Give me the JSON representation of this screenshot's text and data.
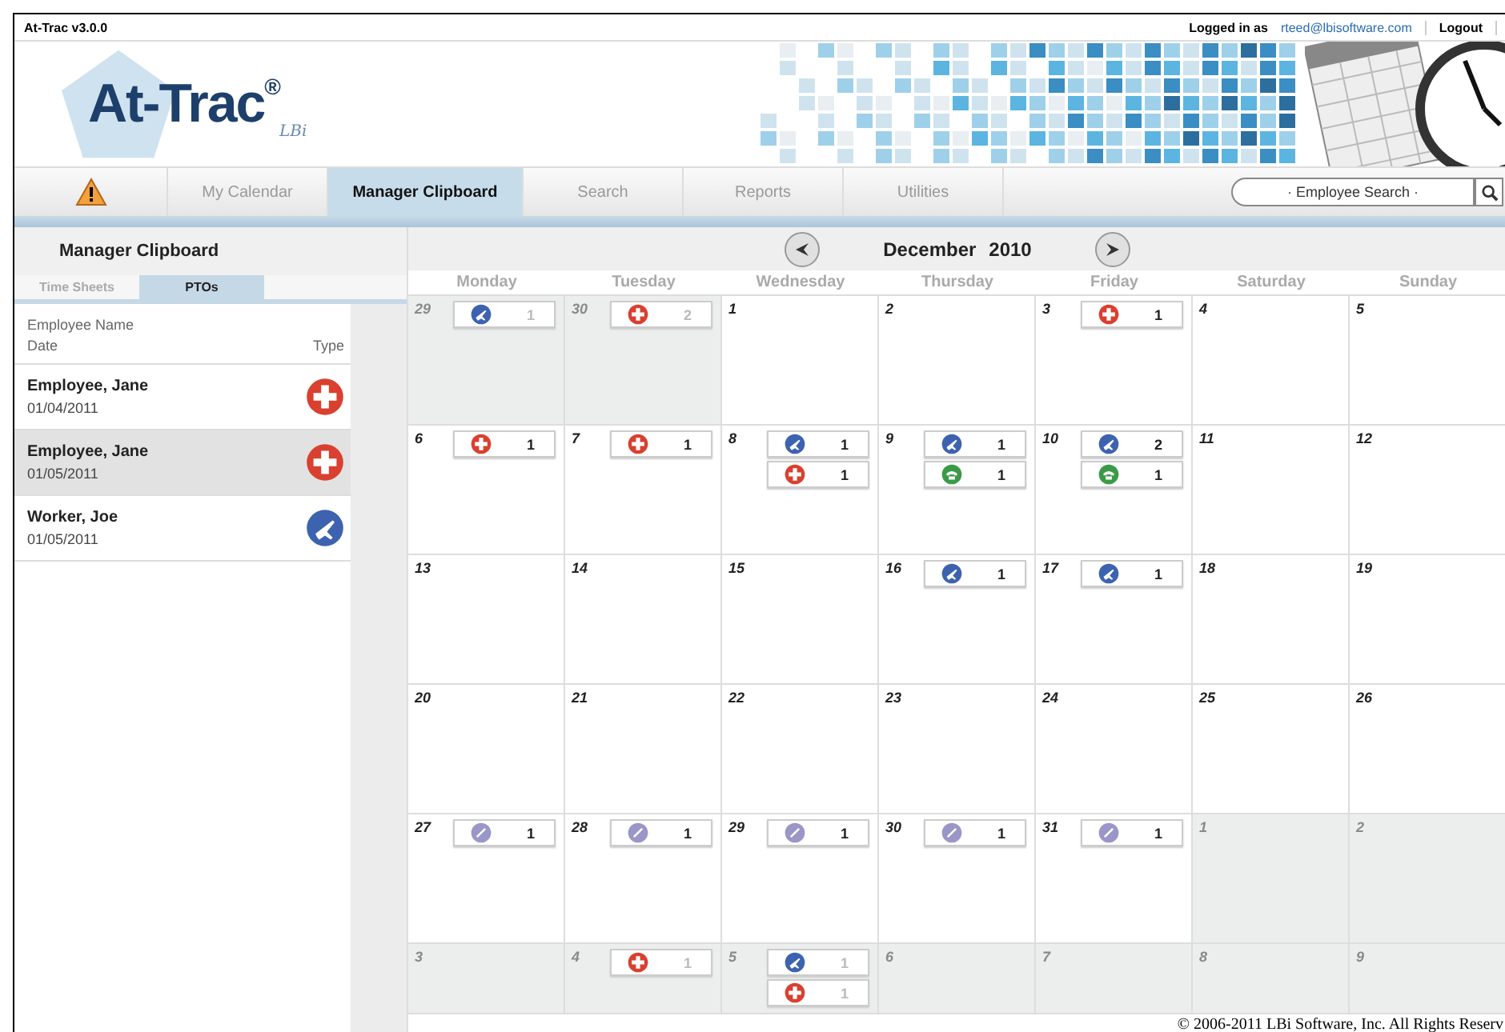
{
  "top_bar": {
    "version": "At-Trac v3.0.0",
    "logged_in_label": "Logged in as",
    "user_email": "rteed@lbisoftware.com",
    "logout": "Logout"
  },
  "logo": {
    "name": "At-Trac",
    "mark": "®",
    "sub": "LBi"
  },
  "nav": {
    "tabs": [
      {
        "label": "My Calendar",
        "selected": false
      },
      {
        "label": "Manager Clipboard",
        "selected": true
      },
      {
        "label": "Search",
        "selected": false
      },
      {
        "label": "Reports",
        "selected": false
      },
      {
        "label": "Utilities",
        "selected": false
      }
    ],
    "search": {
      "placeholder": "· Employee Search ·"
    }
  },
  "sidebar": {
    "title": "Manager Clipboard",
    "tabs": [
      {
        "label": "Time Sheets",
        "selected": false
      },
      {
        "label": "PTOs",
        "selected": true
      }
    ],
    "columns": {
      "name": "Employee Name",
      "date": "Date",
      "type": "Type"
    },
    "rows": [
      {
        "name": "Employee, Jane",
        "date": "01/04/2011",
        "kind": "sick",
        "selected": false
      },
      {
        "name": "Employee, Jane",
        "date": "01/05/2011",
        "kind": "sick",
        "selected": true
      },
      {
        "name": "Worker, Joe",
        "date": "01/05/2011",
        "kind": "travel",
        "selected": false
      }
    ]
  },
  "calendar": {
    "month": "December",
    "year": "2010",
    "weekdays": [
      "Monday",
      "Tuesday",
      "Wednesday",
      "Thursday",
      "Friday",
      "Saturday",
      "Sunday"
    ],
    "weeks": [
      [
        {
          "day": "29",
          "outside": true,
          "entries": [
            {
              "kind": "travel",
              "count": "1"
            }
          ]
        },
        {
          "day": "30",
          "outside": true,
          "entries": [
            {
              "kind": "sick",
              "count": "2"
            }
          ]
        },
        {
          "day": "1",
          "outside": false
        },
        {
          "day": "2",
          "outside": false
        },
        {
          "day": "3",
          "outside": false,
          "entries": [
            {
              "kind": "sick",
              "count": "1"
            }
          ]
        },
        {
          "day": "4",
          "outside": false
        },
        {
          "day": "5",
          "outside": false
        }
      ],
      [
        {
          "day": "6",
          "outside": false,
          "entries": [
            {
              "kind": "sick",
              "count": "1"
            }
          ]
        },
        {
          "day": "7",
          "outside": false,
          "entries": [
            {
              "kind": "sick",
              "count": "1"
            }
          ]
        },
        {
          "day": "8",
          "outside": false,
          "entries": [
            {
              "kind": "travel",
              "count": "1"
            },
            {
              "kind": "sick",
              "count": "1"
            }
          ]
        },
        {
          "day": "9",
          "outside": false,
          "entries": [
            {
              "kind": "travel",
              "count": "1"
            },
            {
              "kind": "phone",
              "count": "1"
            }
          ]
        },
        {
          "day": "10",
          "outside": false,
          "entries": [
            {
              "kind": "travel",
              "count": "2"
            },
            {
              "kind": "phone",
              "count": "1"
            }
          ]
        },
        {
          "day": "11",
          "outside": false
        },
        {
          "day": "12",
          "outside": false
        }
      ],
      [
        {
          "day": "13",
          "outside": false
        },
        {
          "day": "14",
          "outside": false
        },
        {
          "day": "15",
          "outside": false
        },
        {
          "day": "16",
          "outside": false,
          "entries": [
            {
              "kind": "travel",
              "count": "1"
            }
          ]
        },
        {
          "day": "17",
          "outside": false,
          "entries": [
            {
              "kind": "travel",
              "count": "1"
            }
          ]
        },
        {
          "day": "18",
          "outside": false
        },
        {
          "day": "19",
          "outside": false
        }
      ],
      [
        {
          "day": "20",
          "outside": false
        },
        {
          "day": "21",
          "outside": false
        },
        {
          "day": "22",
          "outside": false
        },
        {
          "day": "23",
          "outside": false
        },
        {
          "day": "24",
          "outside": false
        },
        {
          "day": "25",
          "outside": false
        },
        {
          "day": "26",
          "outside": false
        }
      ],
      [
        {
          "day": "27",
          "outside": false,
          "entries": [
            {
              "kind": "holiday",
              "count": "1"
            }
          ]
        },
        {
          "day": "28",
          "outside": false,
          "entries": [
            {
              "kind": "holiday",
              "count": "1"
            }
          ]
        },
        {
          "day": "29",
          "outside": false,
          "entries": [
            {
              "kind": "holiday",
              "count": "1"
            }
          ]
        },
        {
          "day": "30",
          "outside": false,
          "entries": [
            {
              "kind": "holiday",
              "count": "1"
            }
          ]
        },
        {
          "day": "31",
          "outside": false,
          "entries": [
            {
              "kind": "holiday",
              "count": "1"
            }
          ]
        },
        {
          "day": "1",
          "outside": true
        },
        {
          "day": "2",
          "outside": true
        }
      ],
      [
        {
          "day": "3",
          "outside": true
        },
        {
          "day": "4",
          "outside": true,
          "entries": [
            {
              "kind": "sick",
              "count": "1"
            }
          ]
        },
        {
          "day": "5",
          "outside": true,
          "entries": [
            {
              "kind": "travel",
              "count": "1"
            },
            {
              "kind": "sick",
              "count": "1"
            }
          ]
        },
        {
          "day": "6",
          "outside": true
        },
        {
          "day": "7",
          "outside": true
        },
        {
          "day": "8",
          "outside": true
        },
        {
          "day": "9",
          "outside": true
        }
      ]
    ]
  },
  "footer": {
    "copyright": "© 2006-2011 LBi Software, Inc. All Rights Reserv"
  }
}
